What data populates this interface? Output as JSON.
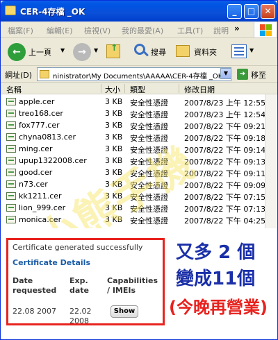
{
  "window": {
    "title": "CER-4存檔 _OK",
    "minimize": "_",
    "maximize": "□",
    "close": "✕"
  },
  "menu": {
    "items": [
      "檔案(F)",
      "編輯(E)",
      "檢視(V)",
      "我的最愛(A)",
      "工具(T)",
      "說明"
    ],
    "more": "»"
  },
  "toolbar": {
    "back_label": "上一頁",
    "search_label": "搜尋",
    "folders_label": "資料夾"
  },
  "address": {
    "label": "網址(D)",
    "path": "ninistrator\\My Documents\\AAAAA\\CER-4存檔 _OK",
    "go_label": "移至"
  },
  "columns": [
    "名稱",
    "大小",
    "類型",
    "修改日期"
  ],
  "files": [
    {
      "name": "apple.cer",
      "size": "3 KB",
      "type": "安全性憑證",
      "date": "2007/8/23 上午 12:55"
    },
    {
      "name": "treo168.cer",
      "size": "3 KB",
      "type": "安全性憑證",
      "date": "2007/8/23 上午 12:54"
    },
    {
      "name": "fox777.cer",
      "size": "3 KB",
      "type": "安全性憑證",
      "date": "2007/8/22 下午 09:21"
    },
    {
      "name": "chyna0813.cer",
      "size": "3 KB",
      "type": "安全性憑證",
      "date": "2007/8/22 下午 09:18"
    },
    {
      "name": "ming.cer",
      "size": "3 KB",
      "type": "安全性憑證",
      "date": "2007/8/22 下午 09:14"
    },
    {
      "name": "upup1322008.cer",
      "size": "3 KB",
      "type": "安全性憑證",
      "date": "2007/8/22 下午 09:13"
    },
    {
      "name": "good.cer",
      "size": "3 KB",
      "type": "安全性憑證",
      "date": "2007/8/22 下午 09:11"
    },
    {
      "name": "n73.cer",
      "size": "3 KB",
      "type": "安全性憑證",
      "date": "2007/8/22 下午 09:09"
    },
    {
      "name": "kk1211.cer",
      "size": "3 KB",
      "type": "安全性憑證",
      "date": "2007/8/22 下午 07:15"
    },
    {
      "name": "lion_999.cer",
      "size": "3 KB",
      "type": "安全性憑證",
      "date": "2007/8/22 下午 07:13"
    },
    {
      "name": "monica.cer",
      "size": "3 KB",
      "type": "安全性憑證",
      "date": "2007/8/22 下午 04:25"
    }
  ],
  "certificate": {
    "status": "Certificate generated successfully",
    "details_link": "Certificate Details",
    "headers": [
      "Date requested",
      "Exp. date",
      "Capabilities / IMEIs"
    ],
    "date_requested": "22.08 2007",
    "exp_date": "22.02 2008",
    "show_button": "Show"
  },
  "promo": {
    "line1": "又多 2 個",
    "line2": "變成11個",
    "line3": "(今晚再營業)"
  },
  "watermark": {
    "text": "小熊手機"
  }
}
